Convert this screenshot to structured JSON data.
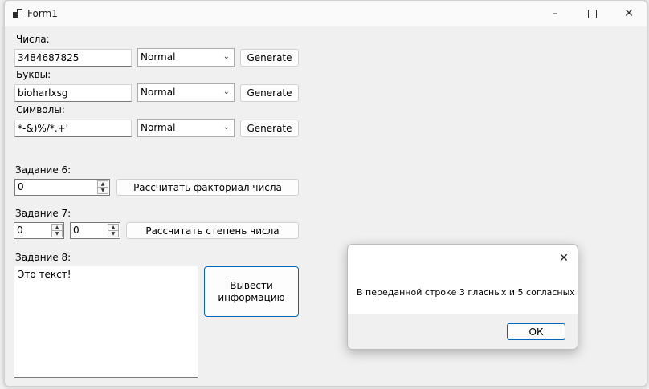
{
  "window": {
    "title": "Form1"
  },
  "numbers": {
    "label": "Числа:",
    "value": "3484687825",
    "mode": "Normal",
    "button": "Generate"
  },
  "letters": {
    "label": "Буквы:",
    "value": "bioharlxsg",
    "mode": "Normal",
    "button": "Generate"
  },
  "symbols": {
    "label": "Символы:",
    "value": "*-&)%/*.+'",
    "mode": "Normal",
    "button": "Generate"
  },
  "task6": {
    "label": "Задание 6:",
    "value": "0",
    "button": "Рассчитать факториал числа"
  },
  "task7": {
    "label": "Задание 7:",
    "value1": "0",
    "value2": "0",
    "button": "Рассчитать степень числа"
  },
  "task8": {
    "label": "Задание 8:",
    "text": "Это текст!",
    "button": "Вывести информацию"
  },
  "dialog": {
    "message": "В переданной строке 3 гласных и 5 согласных",
    "ok": "ОК"
  }
}
